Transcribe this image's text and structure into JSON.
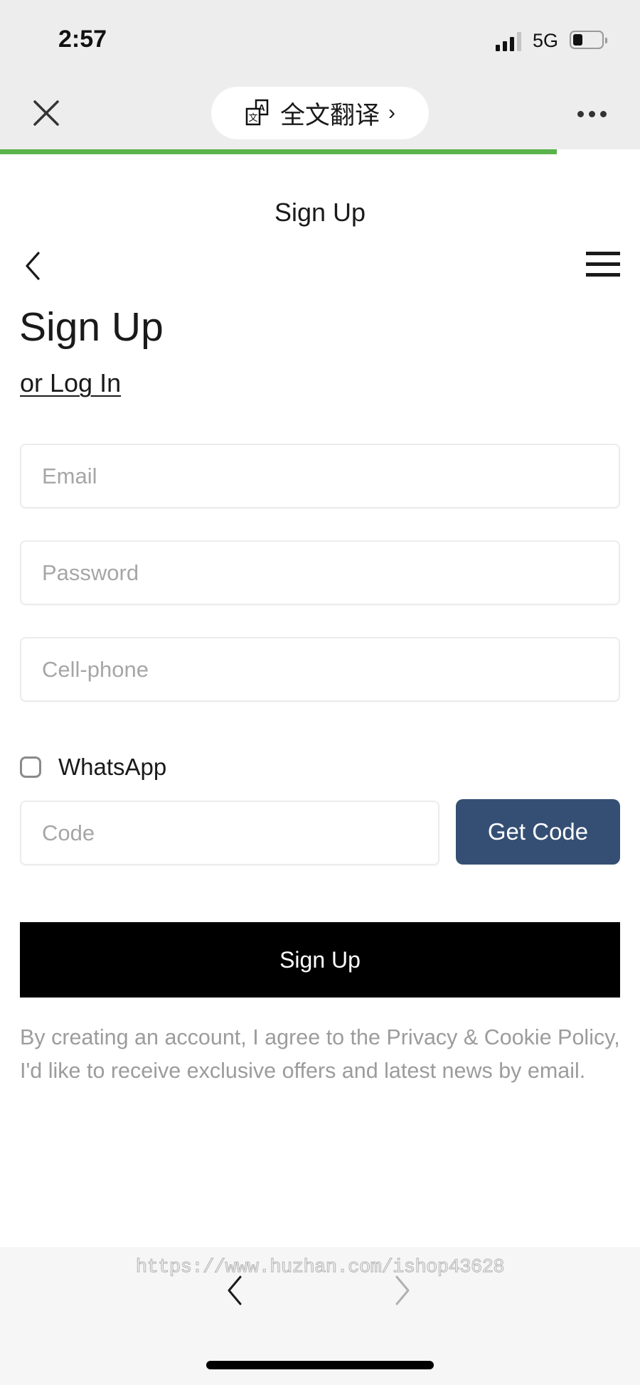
{
  "status_bar": {
    "time": "2:57",
    "network": "5G",
    "signal_bars": 3,
    "signal_bars_total": 4,
    "battery_level_percent": 30
  },
  "browser_nav": {
    "close_icon": "close-icon",
    "translate_icon": "translate-icon",
    "translate_label": "全文翻译",
    "translate_chevron": "›",
    "more_icon": "more-horizontal-icon",
    "page_load_progress_percent": 87,
    "progress_color": "#5ab34a"
  },
  "page": {
    "title": "Sign Up",
    "back_icon": "chevron-left-icon",
    "menu_icon": "hamburger-menu-icon",
    "heading": "Sign Up",
    "login_link": "or Log In"
  },
  "form": {
    "email": {
      "value": "",
      "placeholder": "Email"
    },
    "password": {
      "value": "",
      "placeholder": "Password"
    },
    "cellphone": {
      "value": "",
      "placeholder": "Cell-phone"
    },
    "whatsapp": {
      "label": "WhatsApp",
      "checked": false
    },
    "code": {
      "value": "",
      "placeholder": "Code"
    },
    "get_code_label": "Get Code",
    "get_code_color": "#354f74",
    "submit_label": "Sign Up",
    "submit_color": "#000000"
  },
  "disclaimer": "By creating an account, I agree to the Privacy & Cookie Policy, I'd like to receive exclusive offers and latest news by email.",
  "bottom_bar": {
    "watermark": "https://www.huzhan.com/ishop43628",
    "back_icon": "chevron-left-icon",
    "forward_icon": "chevron-right-icon",
    "forward_enabled": false
  }
}
